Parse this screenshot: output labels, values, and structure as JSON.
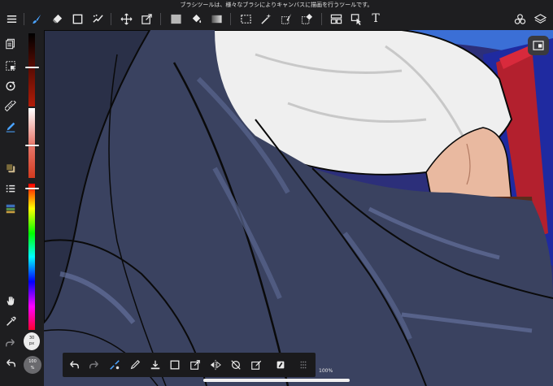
{
  "tooltip": "ブラシツールは、様々なブラシによりキャンバスに描画を行うツールです。",
  "top_toolbar": {
    "tools": [
      {
        "name": "menu",
        "icon": "menu-icon"
      },
      {
        "name": "brush",
        "icon": "brush-icon",
        "active": true
      },
      {
        "name": "eraser",
        "icon": "eraser-icon"
      },
      {
        "name": "shape",
        "icon": "square-icon"
      },
      {
        "name": "smudge",
        "icon": "smudge-icon"
      },
      {
        "name": "move",
        "icon": "move-icon"
      },
      {
        "name": "transform",
        "icon": "transform-icon"
      },
      {
        "name": "fill-color",
        "icon": "fill-swatch-icon"
      },
      {
        "name": "bucket",
        "icon": "bucket-icon"
      },
      {
        "name": "gradient",
        "icon": "gradient-icon"
      },
      {
        "name": "select-rect",
        "icon": "marquee-icon"
      },
      {
        "name": "magic-wand",
        "icon": "magic-wand-icon"
      },
      {
        "name": "select-pen",
        "icon": "select-pen-icon"
      },
      {
        "name": "select-eraser",
        "icon": "select-eraser-icon"
      },
      {
        "name": "frame-divider",
        "icon": "frame-icon"
      },
      {
        "name": "operation",
        "icon": "pointer-icon"
      },
      {
        "name": "text",
        "icon": "text-icon",
        "label": "T"
      },
      {
        "name": "materials",
        "icon": "materials-icon"
      },
      {
        "name": "layers",
        "icon": "layers-icon"
      }
    ]
  },
  "left_toolbar": {
    "items": [
      "pages-icon",
      "selection-icon",
      "rotate-icon",
      "ruler-icon",
      "edit-bar-icon",
      "color-swatch-icon",
      "layer-list-icon",
      "layer-property-icon",
      "hand-icon",
      "eyedropper-icon",
      "redo-icon",
      "undo-icon"
    ]
  },
  "color": {
    "accent": "#4aa3ff",
    "current_hue": "#d33a1e",
    "hue_position": 0.03,
    "lightness_position": 0.52,
    "darkness_position": 0.45
  },
  "brush": {
    "size_value": "30",
    "size_unit": "px",
    "opacity_value": "100",
    "opacity_unit": "%"
  },
  "bottom_toolbar": {
    "items": [
      "undo-icon",
      "redo-icon",
      "brush-settings-icon",
      "pen-icon",
      "save-icon",
      "square-icon",
      "export-icon",
      "flip-icon",
      "no-snap-icon",
      "edit-icon",
      "color-icon",
      "grip-icon"
    ]
  },
  "status": {
    "zoom": "100%"
  }
}
